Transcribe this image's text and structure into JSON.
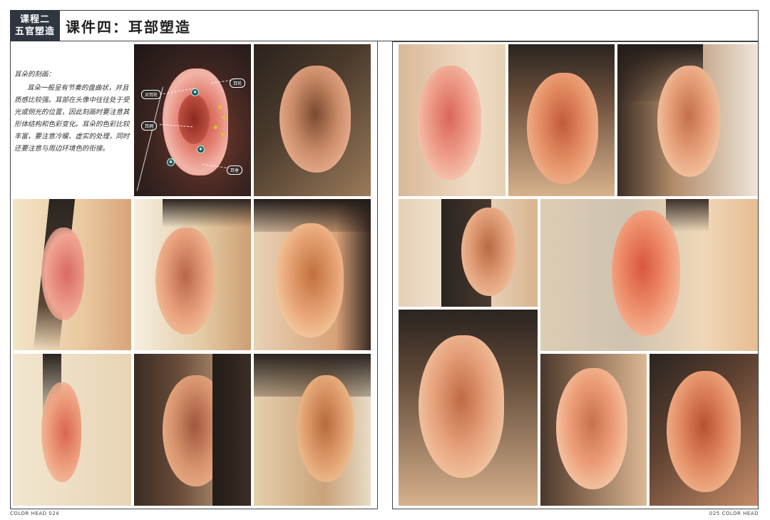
{
  "header": {
    "course_line1": "课程二",
    "course_line2": "五官塑造",
    "title": "课件四：耳部塑造"
  },
  "notes": {
    "title": "耳朵的刻画：",
    "body": "耳朵一般呈有节奏的盘曲状，并且质感比较强。耳部在头像中往往处于受光或侧光的位置，因此刻画时要注意其形体结构和色彩变化。耳朵的色彩比较丰富，要注意冷暖、虚实的处理，同时还要注意与周边环境色的衔接。"
  },
  "diagram": {
    "labels": [
      "耳轮",
      "对耳轮",
      "耳屏",
      "耳垂"
    ]
  },
  "panel_colors": {
    "skin_light": "#f2c9a6",
    "skin_warm": "#e59a78",
    "skin_deep": "#c9674e",
    "hair": "#2a2420",
    "bg_light": "#efe6d6"
  },
  "footer": {
    "left": "COLOR  HEAD   024",
    "right": "025 COLOR  HEAD"
  }
}
